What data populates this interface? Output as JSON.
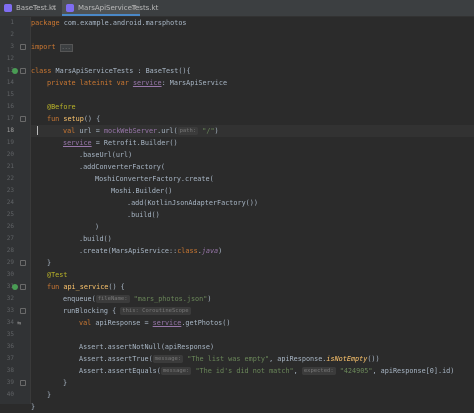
{
  "tabs": [
    {
      "label": "BaseTest.kt",
      "active": false
    },
    {
      "label": "MarsApiServiceTests.kt",
      "active": true
    }
  ],
  "line_numbers": [
    "1",
    "2",
    "3",
    "12",
    "13",
    "14",
    "15",
    "16",
    "17",
    "18",
    "19",
    "20",
    "21",
    "22",
    "23",
    "24",
    "25",
    "26",
    "27",
    "28",
    "29",
    "30",
    "31",
    "32",
    "33",
    "34",
    "35",
    "36",
    "37",
    "38",
    "39",
    "40"
  ],
  "code": {
    "l1_kw": "package",
    "l1_rest": " com.example.android.marsphotos",
    "l3_kw": "import",
    "l3_fold": "...",
    "l12_kw": "class",
    "l12_name": " MarsApiServiceTests : BaseTest(){",
    "l13_kw": "private lateinit var",
    "l13_prop": "service",
    "l13_rest": ": MarsApiService",
    "l15_ann": "@Before",
    "l16_kw": "fun",
    "l16_fn": "setup",
    "l16_rest": "() {",
    "l17_kw": "val",
    "l17_a": " url = ",
    "l17_prop": "mockWebServer",
    "l17_b": ".url(",
    "l17_hint": "path:",
    "l17_str": "\"/\"",
    "l17_c": ")",
    "l18_prop": "service",
    "l18_rest": " = Retrofit.Builder()",
    "l19": ".baseUrl(url)",
    "l20": ".addConverterFactory(",
    "l21": "MoshiConverterFactory.create(",
    "l22": "Moshi.Builder()",
    "l23": ".add(KotlinJsonAdapterFactory())",
    "l24": ".build()",
    "l25": ")",
    "l26": ".build()",
    "l27_a": ".create(MarsApiService::",
    "l27_kw": "class",
    "l27_b": ".",
    "l27_java": "java",
    "l27_c": ")",
    "l28": "}",
    "l30_ann": "@Test",
    "l31_kw": "fun",
    "l31_fn": "api_service",
    "l31_rest": "() {",
    "l32_a": "enqueue(",
    "l32_hint": "fileName:",
    "l32_str": "\"mars_photos.json\"",
    "l32_b": ")",
    "l33_a": "runBlocking {",
    "l33_hint": "this: CoroutineScope",
    "l34_kw": "val",
    "l34_a": " apiResponse = ",
    "l34_prop": "service",
    "l34_b": ".getPhotos()",
    "l36": "Assert.assertNotNull(apiResponse)",
    "l37_a": "Assert.assertTrue(",
    "l37_hint": "message:",
    "l37_str": "\"The list was empty\"",
    "l37_b": ", apiResponse.",
    "l37_fn": "isNotEmpty",
    "l37_c": "())",
    "l38_a": "Assert.assertEquals(",
    "l38_hint1": "message:",
    "l38_str1": "\"The id's did not match\"",
    "l38_b": ", ",
    "l38_hint2": "expected:",
    "l38_str2": "\"424905\"",
    "l38_c": ", apiResponse[0].id)",
    "l39": "}",
    "l40": "}",
    "l41": "}"
  },
  "colors": {
    "background": "#2b2b2b",
    "keyword": "#cc7832",
    "function": "#ffc66d",
    "string": "#6a8759",
    "annotation": "#bbb529",
    "property": "#9876aa"
  }
}
